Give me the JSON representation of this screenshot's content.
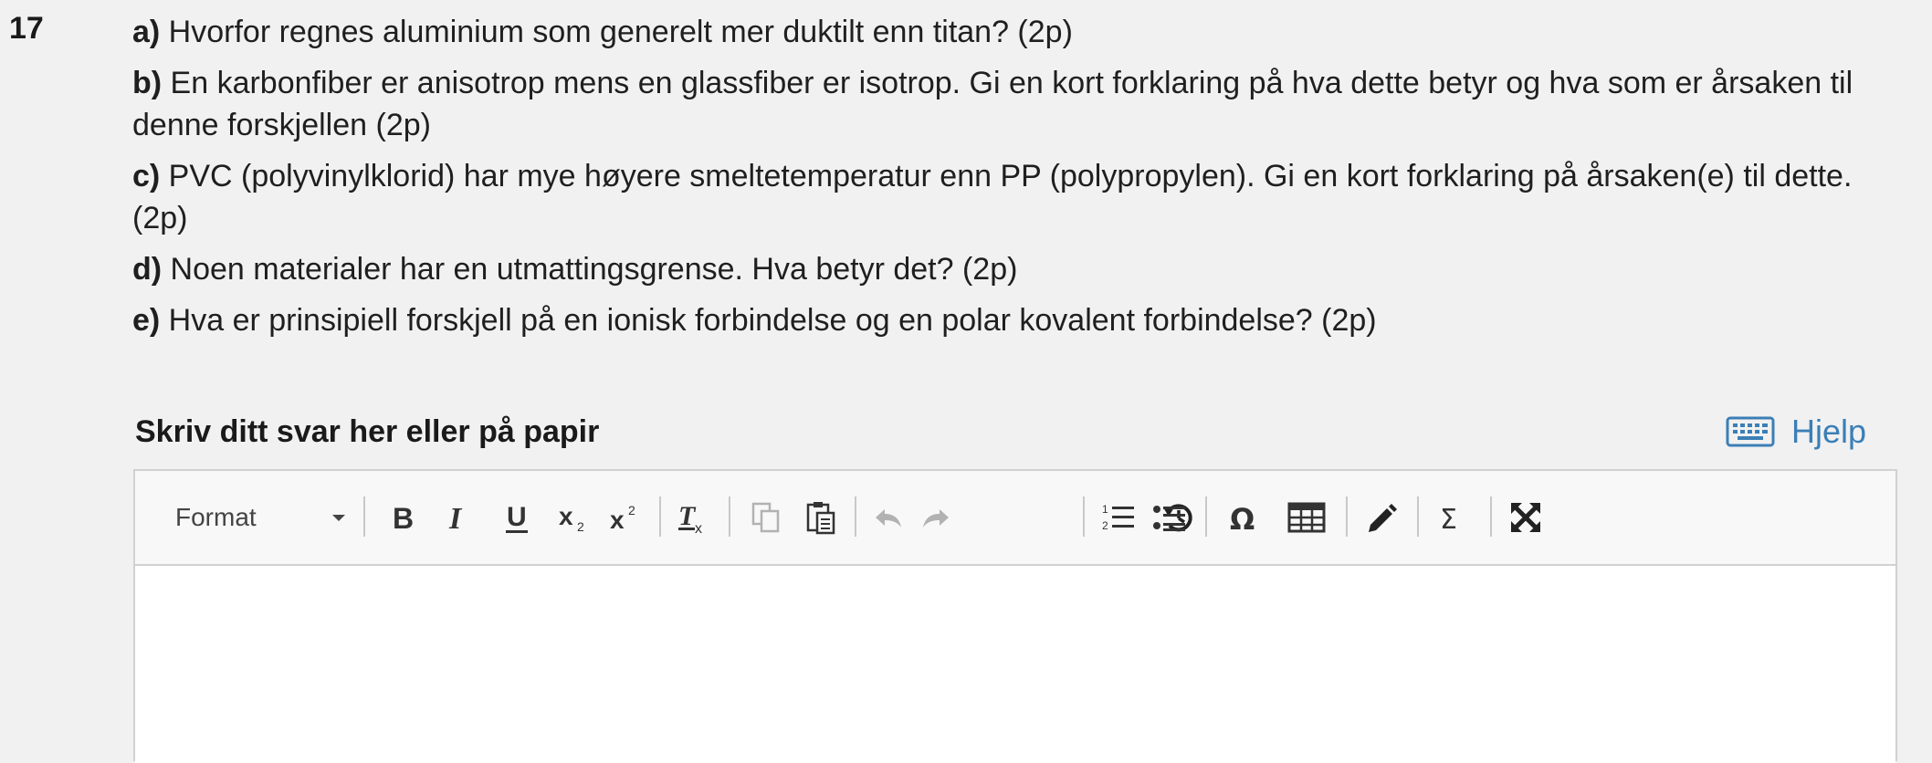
{
  "question": {
    "number": "17",
    "parts": [
      {
        "letter": "a)",
        "text": " Hvorfor regnes aluminium som generelt mer duktilt enn titan? (2p)"
      },
      {
        "letter": "b)",
        "text": " En karbonfiber er anisotrop mens en glassfiber er isotrop. Gi en kort forklaring på hva dette betyr og hva som er årsaken til denne forskjellen (2p)"
      },
      {
        "letter": "c)",
        "text": " PVC (polyvinylklorid) har mye høyere smeltetemperatur enn PP (polypropylen). Gi en kort forklaring på årsaken(e) til dette. (2p)"
      },
      {
        "letter": "d)",
        "text": " Noen materialer har en utmattingsgrense. Hva betyr det? (2p)"
      },
      {
        "letter": "e)",
        "text": " Hva er prinsipiell forskjell på en ionisk forbindelse og en polar kovalent forbindelse? (2p)"
      }
    ]
  },
  "answer": {
    "label": "Skriv ditt svar her eller på papir",
    "help_label": "Hjelp",
    "content": ""
  },
  "toolbar": {
    "format_label": "Format",
    "buttons": [
      "bold",
      "italic",
      "underline",
      "subscript",
      "superscript",
      "remove-format",
      "copy",
      "paste",
      "undo",
      "redo",
      "revert",
      "numbered-list",
      "bulleted-list",
      "special-character",
      "table",
      "drawing",
      "math-formula",
      "fullscreen"
    ]
  },
  "colors": {
    "background": "#f1f1f1",
    "link": "#3b7fb6",
    "editor_border": "#d1d1d1",
    "toolbar_background": "#f8f8f8"
  }
}
